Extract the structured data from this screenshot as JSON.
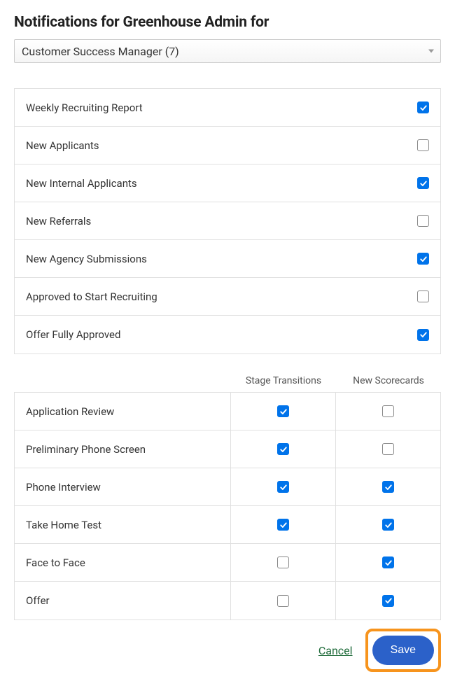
{
  "title": "Notifications for Greenhouse Admin for",
  "dropdown": {
    "selected": "Customer Success Manager (7)"
  },
  "notifications": [
    {
      "label": "Weekly Recruiting Report",
      "checked": true
    },
    {
      "label": "New Applicants",
      "checked": false
    },
    {
      "label": "New Internal Applicants",
      "checked": true
    },
    {
      "label": "New Referrals",
      "checked": false
    },
    {
      "label": "New Agency Submissions",
      "checked": true
    },
    {
      "label": "Approved to Start Recruiting",
      "checked": false
    },
    {
      "label": "Offer Fully Approved",
      "checked": true
    }
  ],
  "stage_headers": {
    "transitions": "Stage Transitions",
    "scorecards": "New Scorecards"
  },
  "stages": [
    {
      "label": "Application Review",
      "transitions": true,
      "scorecards": false
    },
    {
      "label": "Preliminary Phone Screen",
      "transitions": true,
      "scorecards": false
    },
    {
      "label": "Phone Interview",
      "transitions": true,
      "scorecards": true
    },
    {
      "label": "Take Home Test",
      "transitions": true,
      "scorecards": true
    },
    {
      "label": "Face to Face",
      "transitions": false,
      "scorecards": true
    },
    {
      "label": "Offer",
      "transitions": false,
      "scorecards": true
    }
  ],
  "footer": {
    "cancel": "Cancel",
    "save": "Save"
  }
}
